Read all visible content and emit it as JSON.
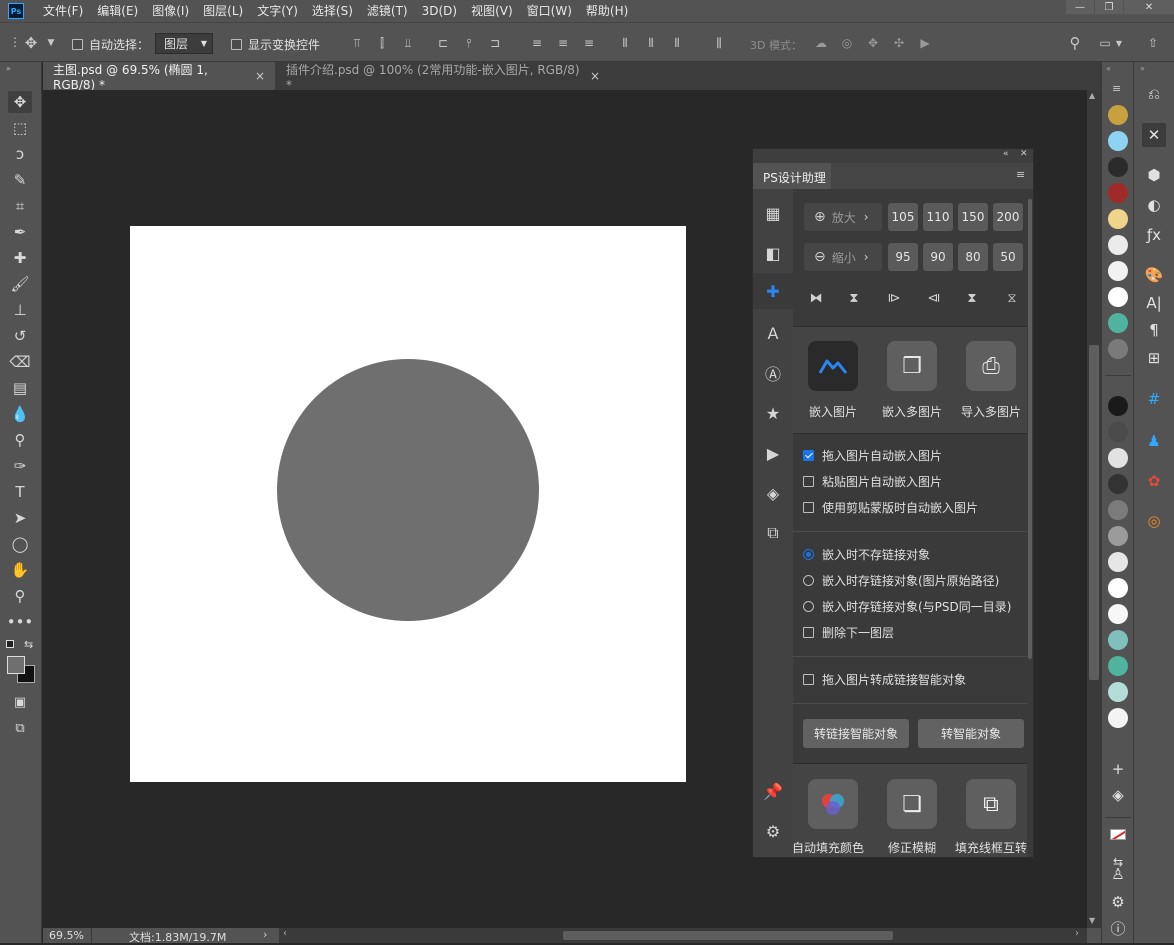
{
  "menu": {
    "logo": "Ps",
    "items": [
      "文件(F)",
      "编辑(E)",
      "图像(I)",
      "图层(L)",
      "文字(Y)",
      "选择(S)",
      "滤镜(T)",
      "3D(D)",
      "视图(V)",
      "窗口(W)",
      "帮助(H)"
    ]
  },
  "options": {
    "auto_select": "自动选择：",
    "layer_select": "图层",
    "show_transform": "显示变换控件",
    "mode_3d": "3D 模式："
  },
  "tabs": [
    {
      "label": "主图.psd @ 69.5% (椭圆 1, RGB/8) *",
      "close": "×"
    },
    {
      "label": "插件介绍.psd @ 100% (2常用功能-嵌入图片, RGB/8) *",
      "close": "×"
    }
  ],
  "status": {
    "zoom": "69.5%",
    "doc": "文档:1.83M/19.7M"
  },
  "plugin": {
    "title": "PS设计助理",
    "zoom_in": {
      "label": "放大",
      "values": [
        "105",
        "110",
        "150",
        "200"
      ]
    },
    "zoom_out": {
      "label": "缩小",
      "values": [
        "95",
        "90",
        "80",
        "50"
      ]
    },
    "embed_buttons": [
      "嵌入图片",
      "嵌入多图片",
      "导入多图片"
    ],
    "checks_1": [
      {
        "label": "拖入图片自动嵌入图片",
        "checked": true
      },
      {
        "label": "粘贴图片自动嵌入图片",
        "checked": false
      },
      {
        "label": "使用剪贴蒙版时自动嵌入图片",
        "checked": false
      }
    ],
    "radios": [
      {
        "label": "嵌入时不存链接对象",
        "checked": true
      },
      {
        "label": "嵌入时存链接对象(图片原始路径)",
        "checked": false
      },
      {
        "label": "嵌入时存链接对象(与PSD同一目录)",
        "checked": false
      }
    ],
    "delete_below": "删除下一图层",
    "to_linked_check": "拖入图片转成链接智能对象",
    "btn_linked": "转链接智能对象",
    "btn_smart": "转智能对象",
    "bottom_labels": [
      "自动填充颜色",
      "修正模糊",
      "填充线框互转"
    ]
  },
  "colors": {
    "accent": "#1b73e8",
    "swatches_top": [
      "#c7a040",
      "#8fd3f2",
      "#2b2b2b",
      "#a02a2a",
      "#efd58b",
      "#ebebeb",
      "#f2f2f2",
      "#ffffff",
      "#4fb39e",
      "#7a7a7a"
    ],
    "swatches_bottom": [
      "#1a1a1a",
      "#4b4b4b",
      "#e2e2e2",
      "#333333",
      "#7b7b7b",
      "#9b9b9b",
      "#e6e6e6",
      "#ffffff",
      "#f7f7f7",
      "#7fc0bb",
      "#4fb39e",
      "#b5ddd7",
      "#f4f4f4"
    ]
  }
}
